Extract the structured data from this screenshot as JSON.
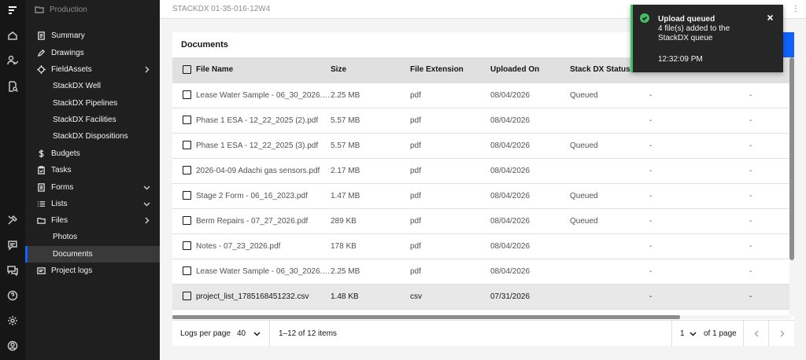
{
  "sidebar": {
    "header": "Production",
    "items": [
      {
        "label": "Summary"
      },
      {
        "label": "Drawings"
      },
      {
        "label": "FieldAssets"
      },
      {
        "label": "StackDX Well"
      },
      {
        "label": "StackDX Pipelines"
      },
      {
        "label": "StackDX Facilities"
      },
      {
        "label": "StackDX Dispositions"
      },
      {
        "label": "Budgets"
      },
      {
        "label": "Tasks"
      },
      {
        "label": "Forms"
      },
      {
        "label": "Lists"
      },
      {
        "label": "Files"
      },
      {
        "label": "Photos"
      },
      {
        "label": "Documents"
      },
      {
        "label": "Project logs"
      }
    ]
  },
  "topbar": {
    "breadcrumb": "STACKDX 01-35-016-12W4"
  },
  "panel": {
    "title": "Documents"
  },
  "table": {
    "headers": [
      "File Name",
      "Size",
      "File Extension",
      "Uploaded On",
      "Stack DX Status",
      "",
      "Docu"
    ],
    "rows": [
      {
        "name": "Lease Water Sample - 06_30_2026.pdf",
        "size": "2.25 MB",
        "ext": "pdf",
        "date": "08/04/2026",
        "status": "Queued",
        "c5": "-",
        "c6": "-"
      },
      {
        "name": "Phase 1 ESA - 12_22_2025 (2).pdf",
        "size": "5.57 MB",
        "ext": "pdf",
        "date": "08/04/2026",
        "status": "",
        "c5": "-",
        "c6": "-"
      },
      {
        "name": "Phase 1 ESA - 12_22_2025 (3).pdf",
        "size": "5.57 MB",
        "ext": "pdf",
        "date": "08/04/2026",
        "status": "Queued",
        "c5": "-",
        "c6": "-"
      },
      {
        "name": "2026-04-09 Adachi gas sensors.pdf",
        "size": "2.17 MB",
        "ext": "pdf",
        "date": "08/04/2026",
        "status": "",
        "c5": "-",
        "c6": "-"
      },
      {
        "name": "Stage 2 Form - 06_16_2023.pdf",
        "size": "1.47 MB",
        "ext": "pdf",
        "date": "08/04/2026",
        "status": "Queued",
        "c5": "-",
        "c6": "-"
      },
      {
        "name": "Berm Repairs - 07_27_2026.pdf",
        "size": "289 KB",
        "ext": "pdf",
        "date": "08/04/2026",
        "status": "Queued",
        "c5": "-",
        "c6": "-"
      },
      {
        "name": "Notes - 07_23_2026.pdf",
        "size": "178 KB",
        "ext": "pdf",
        "date": "08/04/2026",
        "status": "",
        "c5": "-",
        "c6": "-"
      },
      {
        "name": "Lease Water Sample - 06_30_2026.pdf",
        "size": "2.25 MB",
        "ext": "pdf",
        "date": "08/04/2026",
        "status": "",
        "c5": "-",
        "c6": "-"
      },
      {
        "name": "project_list_1785168451232.csv",
        "size": "1.48 KB",
        "ext": "csv",
        "date": "07/31/2026",
        "status": "",
        "c5": "-",
        "c6": "-"
      }
    ]
  },
  "pagination": {
    "per_page_label": "Logs per page",
    "per_page_value": "40",
    "range": "1–12 of 12 items",
    "page_value": "1",
    "page_of": "of 1 page"
  },
  "toast": {
    "title": "Upload queued",
    "subtitle": "4 file(s) added to the StackDX queue",
    "time": "12:32:09 PM"
  },
  "colors": {
    "accent": "#0f62fe",
    "success": "#42be65",
    "sidebar_bg": "#1f1f1f"
  }
}
